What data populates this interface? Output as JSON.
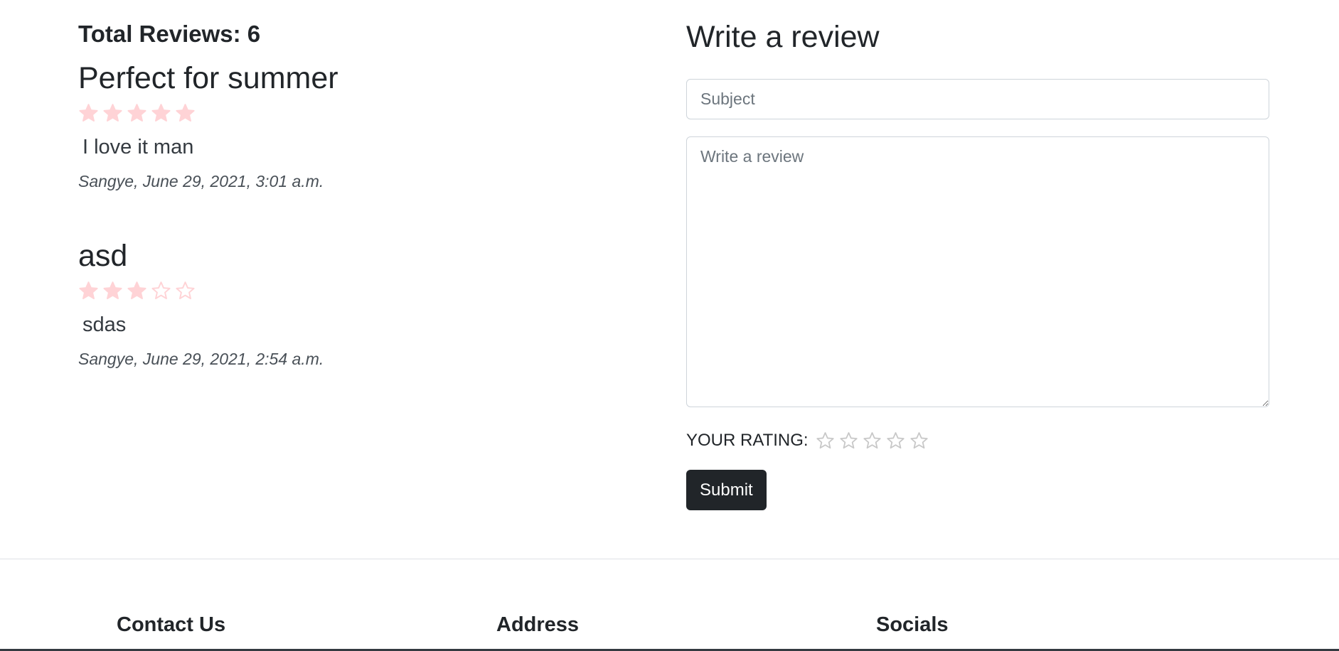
{
  "reviews_section": {
    "total_label": "Total Reviews: 6",
    "reviews": [
      {
        "subject": "Perfect for summer",
        "rating": 5,
        "max_rating": 5,
        "body": "I love it man",
        "meta": "Sangye, June 29, 2021, 3:01 a.m."
      },
      {
        "subject": "asd",
        "rating": 3,
        "max_rating": 5,
        "body": "sdas",
        "meta": "Sangye, June 29, 2021, 2:54 a.m."
      }
    ]
  },
  "review_form": {
    "title": "Write a review",
    "subject_placeholder": "Subject",
    "subject_value": "",
    "review_placeholder": "Write a review",
    "review_value": "",
    "rating_label": "YOUR RATING:",
    "rating_value": 0,
    "rating_max": 5,
    "submit_label": "Submit"
  },
  "footer": {
    "contact_heading": "Contact Us",
    "address_heading": "Address",
    "socials_heading": "Socials"
  },
  "colors": {
    "star_filled": "#ffd3d6",
    "star_outline": "#ffd3d6",
    "rating_star_outline": "#c8c8c8",
    "button_bg": "#212529",
    "text_main": "#212529"
  },
  "icons": {
    "review_star_filled": "star-filled-icon",
    "review_star_empty": "star-outline-icon",
    "rating_star": "star-outline-icon"
  }
}
